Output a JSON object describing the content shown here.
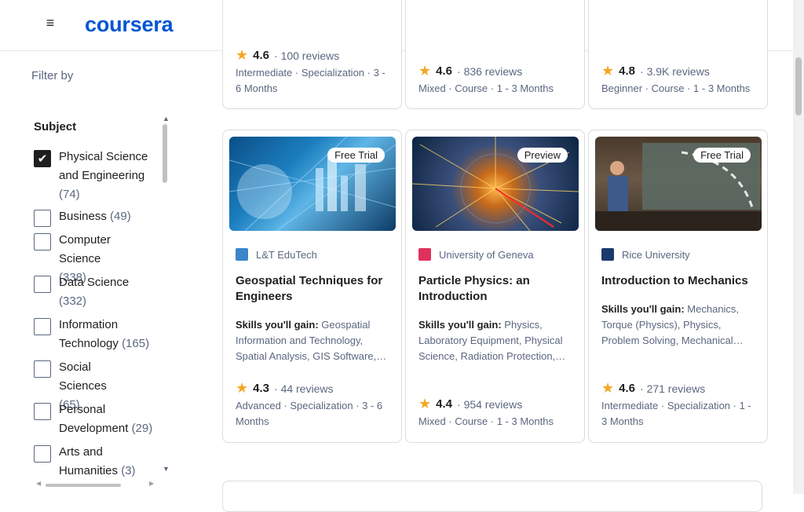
{
  "header": {
    "menu_icon": "≡",
    "logo": "coursera"
  },
  "filter": {
    "title": "Filter by",
    "subject": {
      "title": "Subject",
      "options": [
        {
          "label": "Physical Science and Engineering",
          "count": "(74)",
          "checked": true
        },
        {
          "label": "Business",
          "count": "(49)",
          "checked": false
        },
        {
          "label": "Computer Science",
          "count": "(338)",
          "checked": false
        },
        {
          "label": "Data Science",
          "count": "(332)",
          "checked": false
        },
        {
          "label": "Information Technology",
          "count": "(165)",
          "checked": false
        },
        {
          "label": "Social Sciences",
          "count": "(65)",
          "checked": false
        },
        {
          "label": "Personal Development",
          "count": "(29)",
          "checked": false
        },
        {
          "label": "Arts and Humanities",
          "count": "(3)",
          "checked": false
        }
      ]
    }
  },
  "top_cards": [
    {
      "rating": "4.6",
      "reviews": "100 reviews",
      "meta": "Intermediate · Specialization · 3 - 6 Months"
    },
    {
      "rating": "4.6",
      "reviews": "836 reviews",
      "meta": "Mixed · Course · 1 - 3 Months"
    },
    {
      "rating": "4.8",
      "reviews": "3.9K reviews",
      "meta": "Beginner · Course · 1 - 3 Months"
    }
  ],
  "cards": [
    {
      "badge": "Free Trial",
      "partner": "L&T EduTech",
      "title": "Geospatial Techniques for Engineers",
      "skills_label": "Skills you'll gain:",
      "skills": "Geospatial Information and Technology, Spatial Analysis, GIS Software,…",
      "rating": "4.3",
      "reviews": "44 reviews",
      "meta": "Advanced · Specialization · 3 - 6 Months"
    },
    {
      "badge": "Preview",
      "partner": "University of Geneva",
      "title": "Particle Physics: an Introduction",
      "skills_label": "Skills you'll gain:",
      "skills": "Physics, Laboratory Equipment, Physical Science, Radiation Protection,…",
      "rating": "4.4",
      "reviews": "954 reviews",
      "meta": "Mixed · Course · 1 - 3 Months"
    },
    {
      "badge": "Free Trial",
      "partner": "Rice University",
      "title": "Introduction to Mechanics",
      "skills_label": "Skills you'll gain:",
      "skills": "Mechanics, Torque (Physics), Physics, Problem Solving, Mechanical…",
      "rating": "4.6",
      "reviews": "271 reviews",
      "meta": "Intermediate · Specialization · 1 - 3 Months"
    }
  ],
  "colors": {
    "brand": "#0056d2",
    "star": "#f5a623",
    "muted": "#5b6780"
  },
  "icons": [
    "menu-icon",
    "checkmark-icon",
    "star-icon",
    "scroll-up-icon",
    "scroll-down-icon"
  ]
}
